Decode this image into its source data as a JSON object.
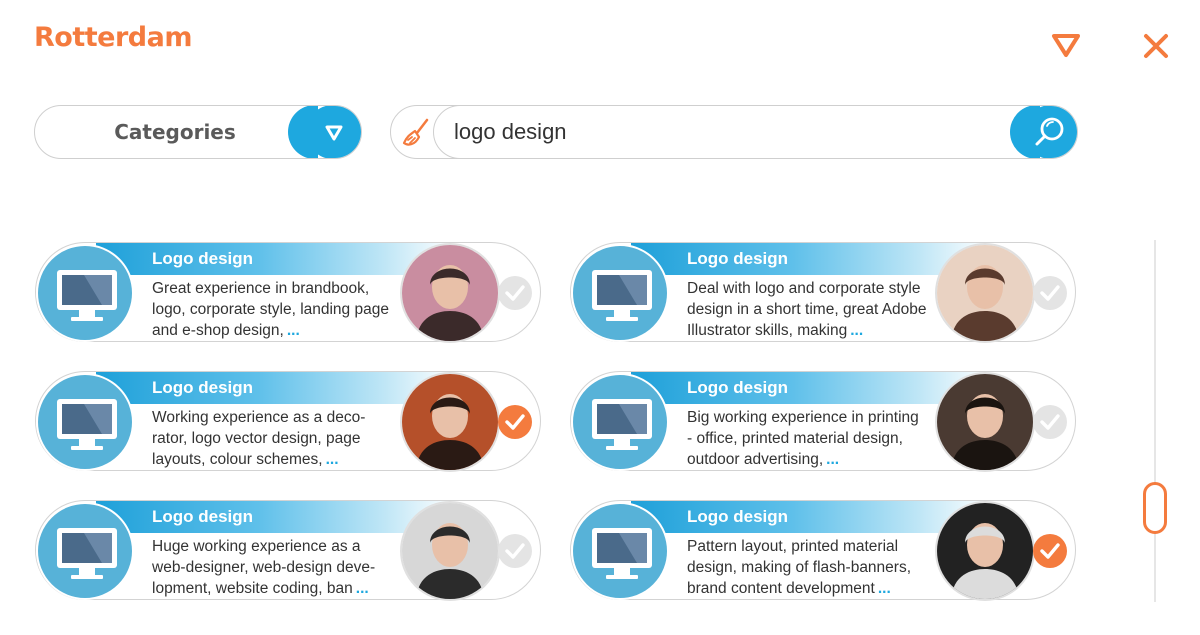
{
  "header": {
    "title": "Rotterdam"
  },
  "categories": {
    "label": "Categories"
  },
  "search": {
    "value": "logo design"
  },
  "colors": {
    "accent": "#f47b3e",
    "primary": "#1ea8df"
  },
  "cards": [
    {
      "title": "Logo design",
      "description": "Great experience in brandbook, logo, corporate style, landing page and e-shop design,",
      "more": "...",
      "selected": false
    },
    {
      "title": "Logo design",
      "description": "Deal with logo and corporate style design in a short time, great Adobe Illustrator skills, making",
      "more": "...",
      "selected": false
    },
    {
      "title": "Logo design",
      "description": "Working experience as a deco-rator, logo vector design, page layouts, colour schemes,",
      "more": "...",
      "selected": true
    },
    {
      "title": "Logo design",
      "description": "Big working experience in printing - office, printed material design, outdoor advertising,",
      "more": "...",
      "selected": false
    },
    {
      "title": "Logo design",
      "description": "Huge working experience as a web-designer, web-design deve-lopment, website coding, ban",
      "more": "...",
      "selected": false
    },
    {
      "title": "Logo design",
      "description": "Pattern layout, printed material design, making of flash-banners, brand content development",
      "more": "...",
      "selected": true
    }
  ]
}
